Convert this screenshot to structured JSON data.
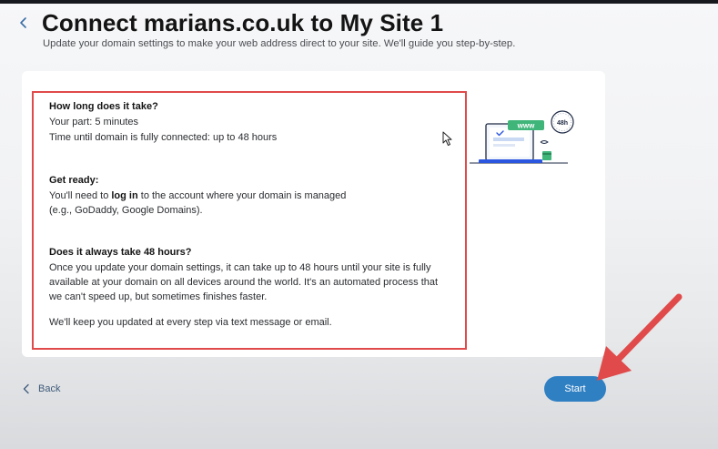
{
  "header": {
    "title": "Connect marians.co.uk to My Site 1",
    "subtitle": "Update your domain settings to make your web address direct to your site. We'll guide you step-by-step."
  },
  "info": {
    "how_long": {
      "heading": "How long does it take?",
      "your_part": "Your part: 5 minutes",
      "time_until": "Time until domain is fully connected: up to 48 hours"
    },
    "get_ready": {
      "heading": "Get ready:",
      "line1_prefix": "You'll need to ",
      "line1_bold": "log in",
      "line1_suffix": " to the account where your domain is managed",
      "line2": "(e.g., GoDaddy, Google Domains)."
    },
    "always_48": {
      "heading": "Does it always take 48 hours?",
      "line1": "Once you update your domain settings, it can take up to 48 hours until your site is fully",
      "line2": "available at your domain on all devices around the world. It's an automated process that",
      "line3": "we can't speed up, but sometimes finishes faster."
    },
    "updates": "We'll keep you updated at every step via text message or email."
  },
  "illustration": {
    "www_label": "www",
    "clock_label": "48h"
  },
  "footer": {
    "back_label": "Back",
    "start_label": "Start"
  },
  "colors": {
    "accent": "#2f7fc3",
    "annotation_red": "#e04a4a",
    "illustration_green": "#3fb57a",
    "link_blue": "#3f5a7a"
  },
  "icons": [
    "chevron-left-icon",
    "mouse-cursor-icon",
    "laptop-illustration",
    "clock-icon",
    "annotation-arrow"
  ]
}
